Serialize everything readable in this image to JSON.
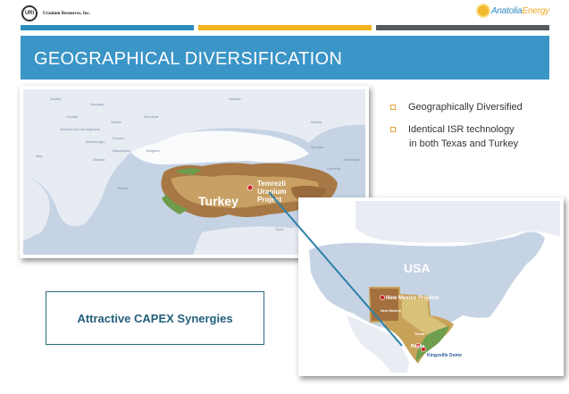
{
  "header": {
    "company_logo_text": "URI",
    "company_name": "Uranium Resources, Inc.",
    "partner_name_part1": "Anatolia",
    "partner_name_part2": "Energy"
  },
  "slide": {
    "title": "GEOGRAPHICAL DIVERSIFICATION",
    "bullets": [
      {
        "lines": [
          "Geographically Diversified"
        ]
      },
      {
        "lines": [
          "Identical ISR technology",
          "in both Texas and Turkey"
        ]
      }
    ],
    "callout": "Attractive CAPEX Synergies"
  },
  "turkey_map": {
    "country_label": "Turkey",
    "project_label_lines": [
      "Temrezli",
      "Uranium",
      "Project"
    ],
    "neighbors": [
      "Austria",
      "Hungary",
      "Ukraine",
      "Romania",
      "Russia",
      "Croatia",
      "Serbia",
      "Bosnia and Herzegovina",
      "Bulgaria",
      "Italy",
      "Montenegro",
      "Kosovo",
      "Macedonia",
      "Albania",
      "Greece",
      "Georgia",
      "Armenia",
      "Azerbaijan",
      "Syria",
      "Iraq"
    ]
  },
  "usa_map": {
    "country_label": "USA",
    "projects": [
      "New Mexico Projects",
      "New Mexico",
      "Rosita",
      "Kingsville Dome",
      "Texas"
    ]
  },
  "colors": {
    "accent_blue": "#3b95c7",
    "accent_orange": "#f5b41d",
    "accent_gray": "#555a5f",
    "callout_text": "#245f7a",
    "connector": "#2c7fa8"
  }
}
